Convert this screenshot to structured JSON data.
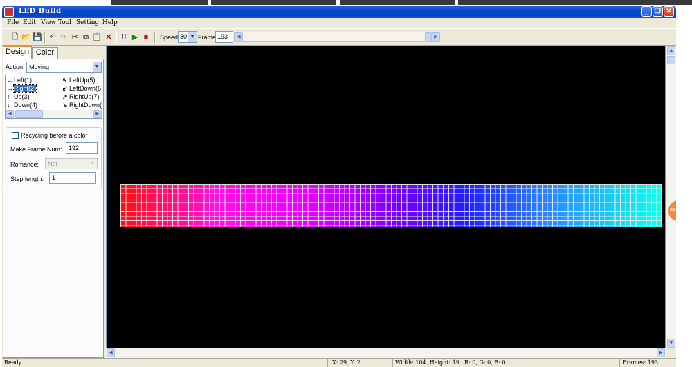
{
  "window": {
    "title": "LED Build"
  },
  "menu": [
    "File",
    "Edit",
    "View",
    "Tool",
    "Setting",
    "Help"
  ],
  "toolbar": {
    "speed_label": "Speed:",
    "speed_value": "30",
    "frame_label": "Frame:",
    "frame_value": "193",
    "icons": [
      "new-file-icon",
      "open-folder-icon",
      "save-icon",
      "undo-icon",
      "redo-icon",
      "cut-icon",
      "copy-icon",
      "paste-icon",
      "delete-icon",
      "grid-icon",
      "play-icon",
      "stop-icon"
    ]
  },
  "tabs": [
    {
      "label": "Design",
      "active": true
    },
    {
      "label": "Color",
      "active": false
    }
  ],
  "design": {
    "action_label": "Action:",
    "action_value": "Moving",
    "directions": [
      {
        "glyph": "←",
        "label": "Left(1)"
      },
      {
        "glyph": "→",
        "label": "Right(2)",
        "selected": true
      },
      {
        "glyph": "↑",
        "label": "Up(3)"
      },
      {
        "glyph": "↓",
        "label": "Down(4)"
      },
      {
        "glyph": "↖",
        "label": "LeftUp(5)"
      },
      {
        "glyph": "↙",
        "label": "LeftDown(6"
      },
      {
        "glyph": "↗",
        "label": "RightUp(7)"
      },
      {
        "glyph": "↘",
        "label": "RightDown("
      }
    ],
    "recycling_label": "Recycling before a color",
    "make_frame_label": "Make Frame Num:",
    "make_frame_value": "192",
    "romance_label": "Romance:",
    "romance_value": "Not",
    "step_label": "Step length:",
    "step_value": "1"
  },
  "canvas": {
    "background": "#000000",
    "side_badge": "61"
  },
  "status": {
    "ready": "Ready",
    "coords": "X: 29, Y: 2",
    "size": "Width: 104 ,Height: 19",
    "rgb": "R:  0, G:  0, B:  0",
    "frames": "Frames: 193"
  }
}
